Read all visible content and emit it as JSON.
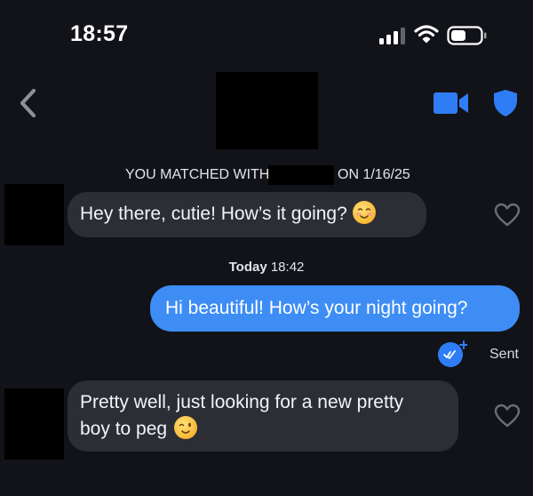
{
  "status_bar": {
    "time": "18:57"
  },
  "header": {
    "back_label": "back",
    "video_label": "video call",
    "safety_label": "safety"
  },
  "match_info": {
    "prefix": "YOU MATCHED WITH",
    "suffix": "ON 1/16/25"
  },
  "timestamp": {
    "day": "Today",
    "time": "18:42"
  },
  "messages": [
    {
      "direction": "incoming",
      "text": "Hey there, cutie! How’s it going?",
      "emoji": "smiling-blush-emoji"
    },
    {
      "direction": "outgoing",
      "text": "Hi beautiful! How’s your night going?"
    },
    {
      "direction": "incoming",
      "line1": "Pretty well, just looking for a new pretty",
      "line2": "boy to peg",
      "emoji": "winking-emoji"
    }
  ],
  "receipt": {
    "status": "Sent"
  },
  "colors": {
    "background": "#111318",
    "incoming_bubble": "#2c2e36",
    "outgoing_bubble": "#3d8df5",
    "accent": "#2f7df6"
  }
}
